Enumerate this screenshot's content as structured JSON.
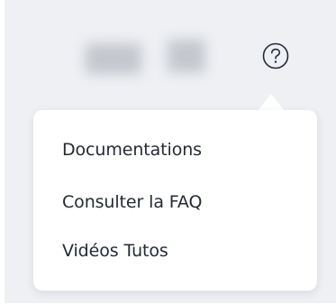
{
  "header": {
    "help_icon": "question-circle-icon"
  },
  "help_menu": {
    "items": [
      {
        "label": "Documentations"
      },
      {
        "label": "Consulter la FAQ"
      },
      {
        "label": "Vidéos Tutos"
      }
    ]
  },
  "colors": {
    "background": "#eef0f4",
    "menu_background": "#ffffff",
    "menu_text": "#232a36",
    "icon": "#232a36"
  }
}
